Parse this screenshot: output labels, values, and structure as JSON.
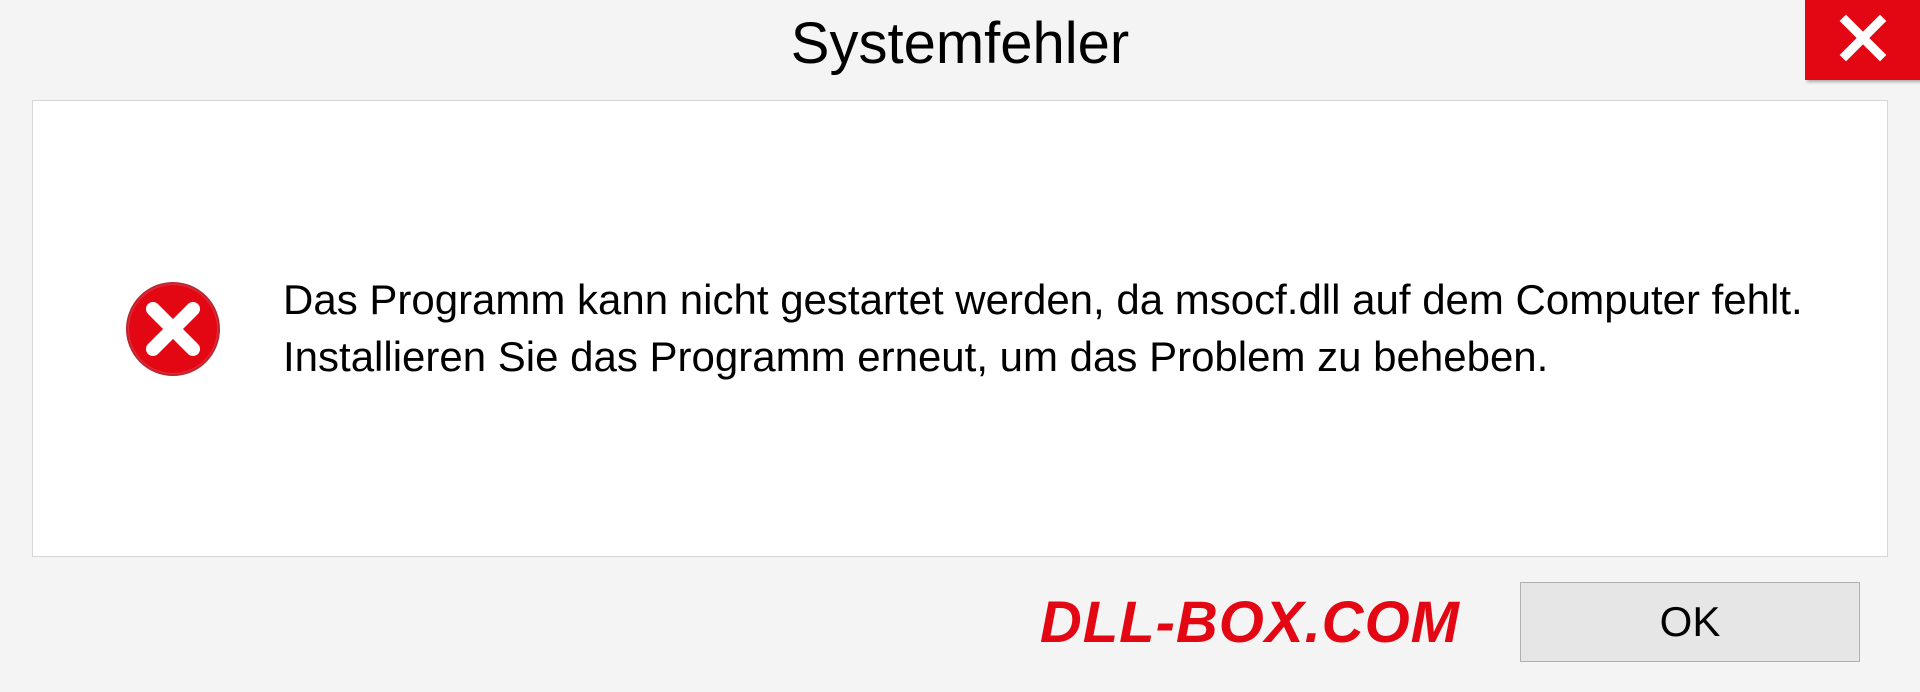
{
  "dialog": {
    "title": "Systemfehler",
    "message": "Das Programm kann nicht gestartet werden, da msocf.dll auf dem Computer fehlt. Installieren Sie das Programm erneut, um das Problem zu beheben.",
    "ok_label": "OK"
  },
  "watermark": {
    "text": "DLL-BOX.COM"
  },
  "colors": {
    "accent_red": "#e30613",
    "panel_bg": "#ffffff",
    "dialog_bg": "#f4f4f4",
    "button_bg": "#e6e6e6"
  }
}
